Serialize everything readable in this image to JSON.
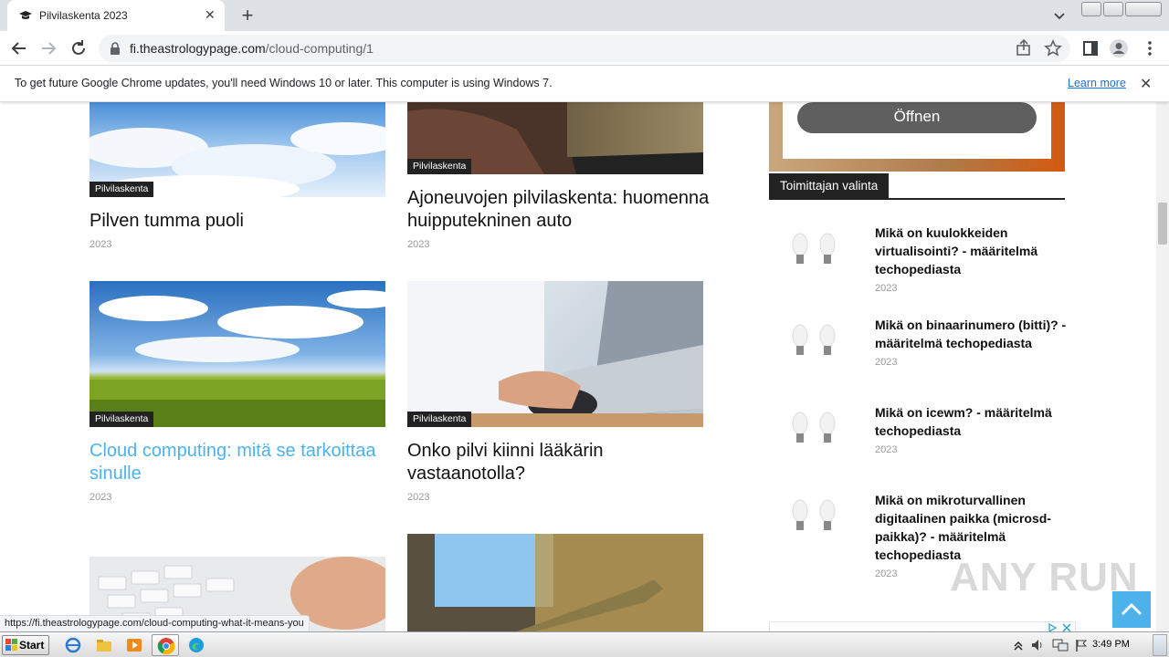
{
  "browser": {
    "tab_title": "Pilvilaskenta 2023",
    "url_domain": "fi.theastrologypage.com",
    "url_path": "/cloud-computing/1"
  },
  "infobar": {
    "message": "To get future Google Chrome updates, you'll need Windows 10 or later. This computer is using Windows 7.",
    "learn_more": "Learn more"
  },
  "articles": [
    {
      "category": "Pilvilaskenta",
      "title": "Pilven tumma puoli",
      "date": "2023"
    },
    {
      "category": "Pilvilaskenta",
      "title": "Ajoneuvojen pilvilaskenta: huomenna huipputekninen auto",
      "date": "2023"
    },
    {
      "category": "Pilvilaskenta",
      "title": "Cloud computing: mitä se tarkoittaa sinulle",
      "date": "2023"
    },
    {
      "category": "Pilvilaskenta",
      "title": "Onko pilvi kiinni lääkärin vastaanotolla?",
      "date": "2023"
    }
  ],
  "sidebar": {
    "ad_button": "Öffnen",
    "editors_pick_label": "Toimittajan valinta",
    "items": [
      {
        "title": "Mikä on kuulokkeiden virtualisointi? - määritelmä techopediasta",
        "date": "2023"
      },
      {
        "title": "Mikä on binaarinumero (bitti)? - määritelmä techopediasta",
        "date": "2023"
      },
      {
        "title": "Mikä on icewm? - määritelmä techopediasta",
        "date": "2023"
      },
      {
        "title": "Mikä on mikroturvallinen digitaalinen paikka (microsd-paikka)? - määritelmä techopediasta",
        "date": "2023"
      }
    ]
  },
  "status_url": "https://fi.theastrologypage.com/cloud-computing-what-it-means-you",
  "taskbar": {
    "start_label": "Start",
    "clock": "3:49 PM"
  },
  "watermark": "ANY RUN",
  "colors": {
    "link_blue": "#4db2ec",
    "accent": "#1a73e8"
  }
}
